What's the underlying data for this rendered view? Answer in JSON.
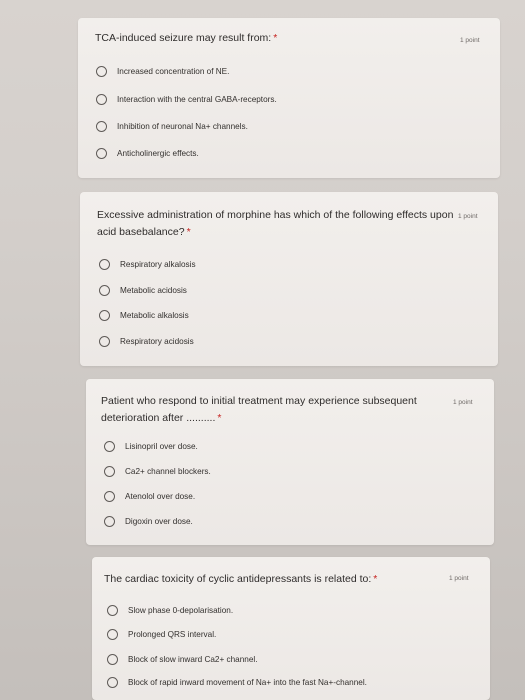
{
  "questions": [
    {
      "title": "TCA-induced seizure may result from:",
      "required_marker": "*",
      "points": "1 point",
      "options": [
        "Increased concentration of NE.",
        "Interaction with the central GABA-receptors.",
        "Inhibition of neuronal Na+ channels.",
        "Anticholinergic effects."
      ]
    },
    {
      "title": "Excessive administration of morphine has which of the following effects upon acid basebalance?",
      "required_marker": "*",
      "points": "1 point",
      "options": [
        "Respiratory alkalosis",
        "Metabolic acidosis",
        "Metabolic alkalosis",
        "Respiratory acidosis"
      ]
    },
    {
      "title": "Patient who respond to initial treatment may experience subsequent deterioration after ..........",
      "required_marker": "*",
      "points": "1 point",
      "options": [
        "Lisinopril over dose.",
        "Ca2+ channel blockers.",
        "Atenolol over dose.",
        "Digoxin over dose."
      ]
    },
    {
      "title": "The cardiac toxicity of cyclic antidepressants is related to:",
      "required_marker": "*",
      "points": "1 point",
      "options": [
        "Slow phase 0-depolarisation.",
        "Prolonged QRS interval.",
        "Block of slow inward Ca2+ channel.",
        "Block of rapid inward movement of Na+ into the fast Na+-channel."
      ]
    }
  ]
}
